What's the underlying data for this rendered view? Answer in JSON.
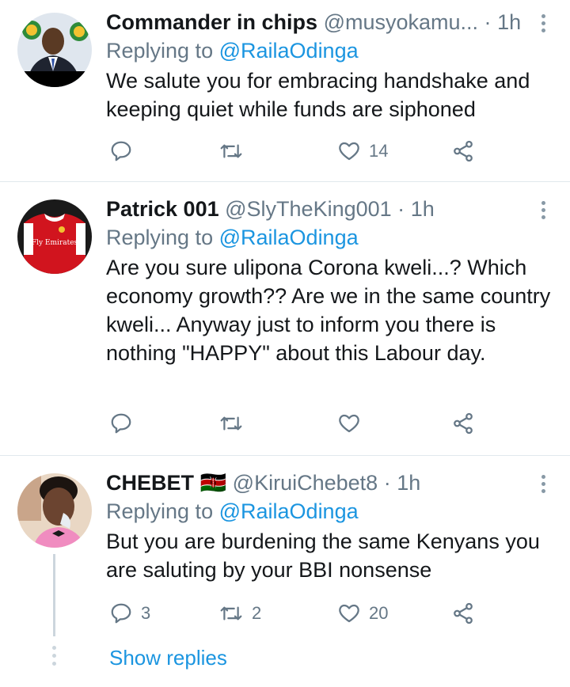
{
  "tweets": [
    {
      "name": "Commander in chips",
      "handle": "@musyokamu...",
      "separator": "·",
      "time": "1h",
      "replying_prefix": "Replying to",
      "replying_to": "@RailaOdinga",
      "text": "We salute you for embracing handshake and keeping quiet while funds are siphoned",
      "reply_count": "",
      "retweet_count": "",
      "like_count": "14"
    },
    {
      "name": "Patrick 001",
      "handle": "@SlyTheKing001",
      "separator": "·",
      "time": "1h",
      "replying_prefix": "Replying to",
      "replying_to": "@RailaOdinga",
      "text": "Are you sure ulipona Corona kweli...? Which economy growth?? Are we in the same country kweli... Anyway just to inform you there is nothing \"HAPPY\" about this Labour day.",
      "avatar_shirt_text": "Fly Emirates",
      "reply_count": "",
      "retweet_count": "",
      "like_count": ""
    },
    {
      "name": "CHEBET",
      "flag": "🇰🇪",
      "handle": "@KiruiChebet8",
      "separator": "·",
      "time": "1h",
      "replying_prefix": "Replying to",
      "replying_to": "@RailaOdinga",
      "text": "But you are burdening the same Kenyans you are saluting by your BBI nonsense",
      "reply_count": "3",
      "retweet_count": "2",
      "like_count": "20"
    }
  ],
  "show_replies": "Show replies",
  "icons": {
    "reply": "reply-icon",
    "retweet": "retweet-icon",
    "like": "heart-icon",
    "share": "share-icon",
    "more": "more-vertical-icon"
  },
  "colors": {
    "link": "#1b95e0",
    "secondary": "#657786",
    "divider": "#e1e8ed"
  }
}
